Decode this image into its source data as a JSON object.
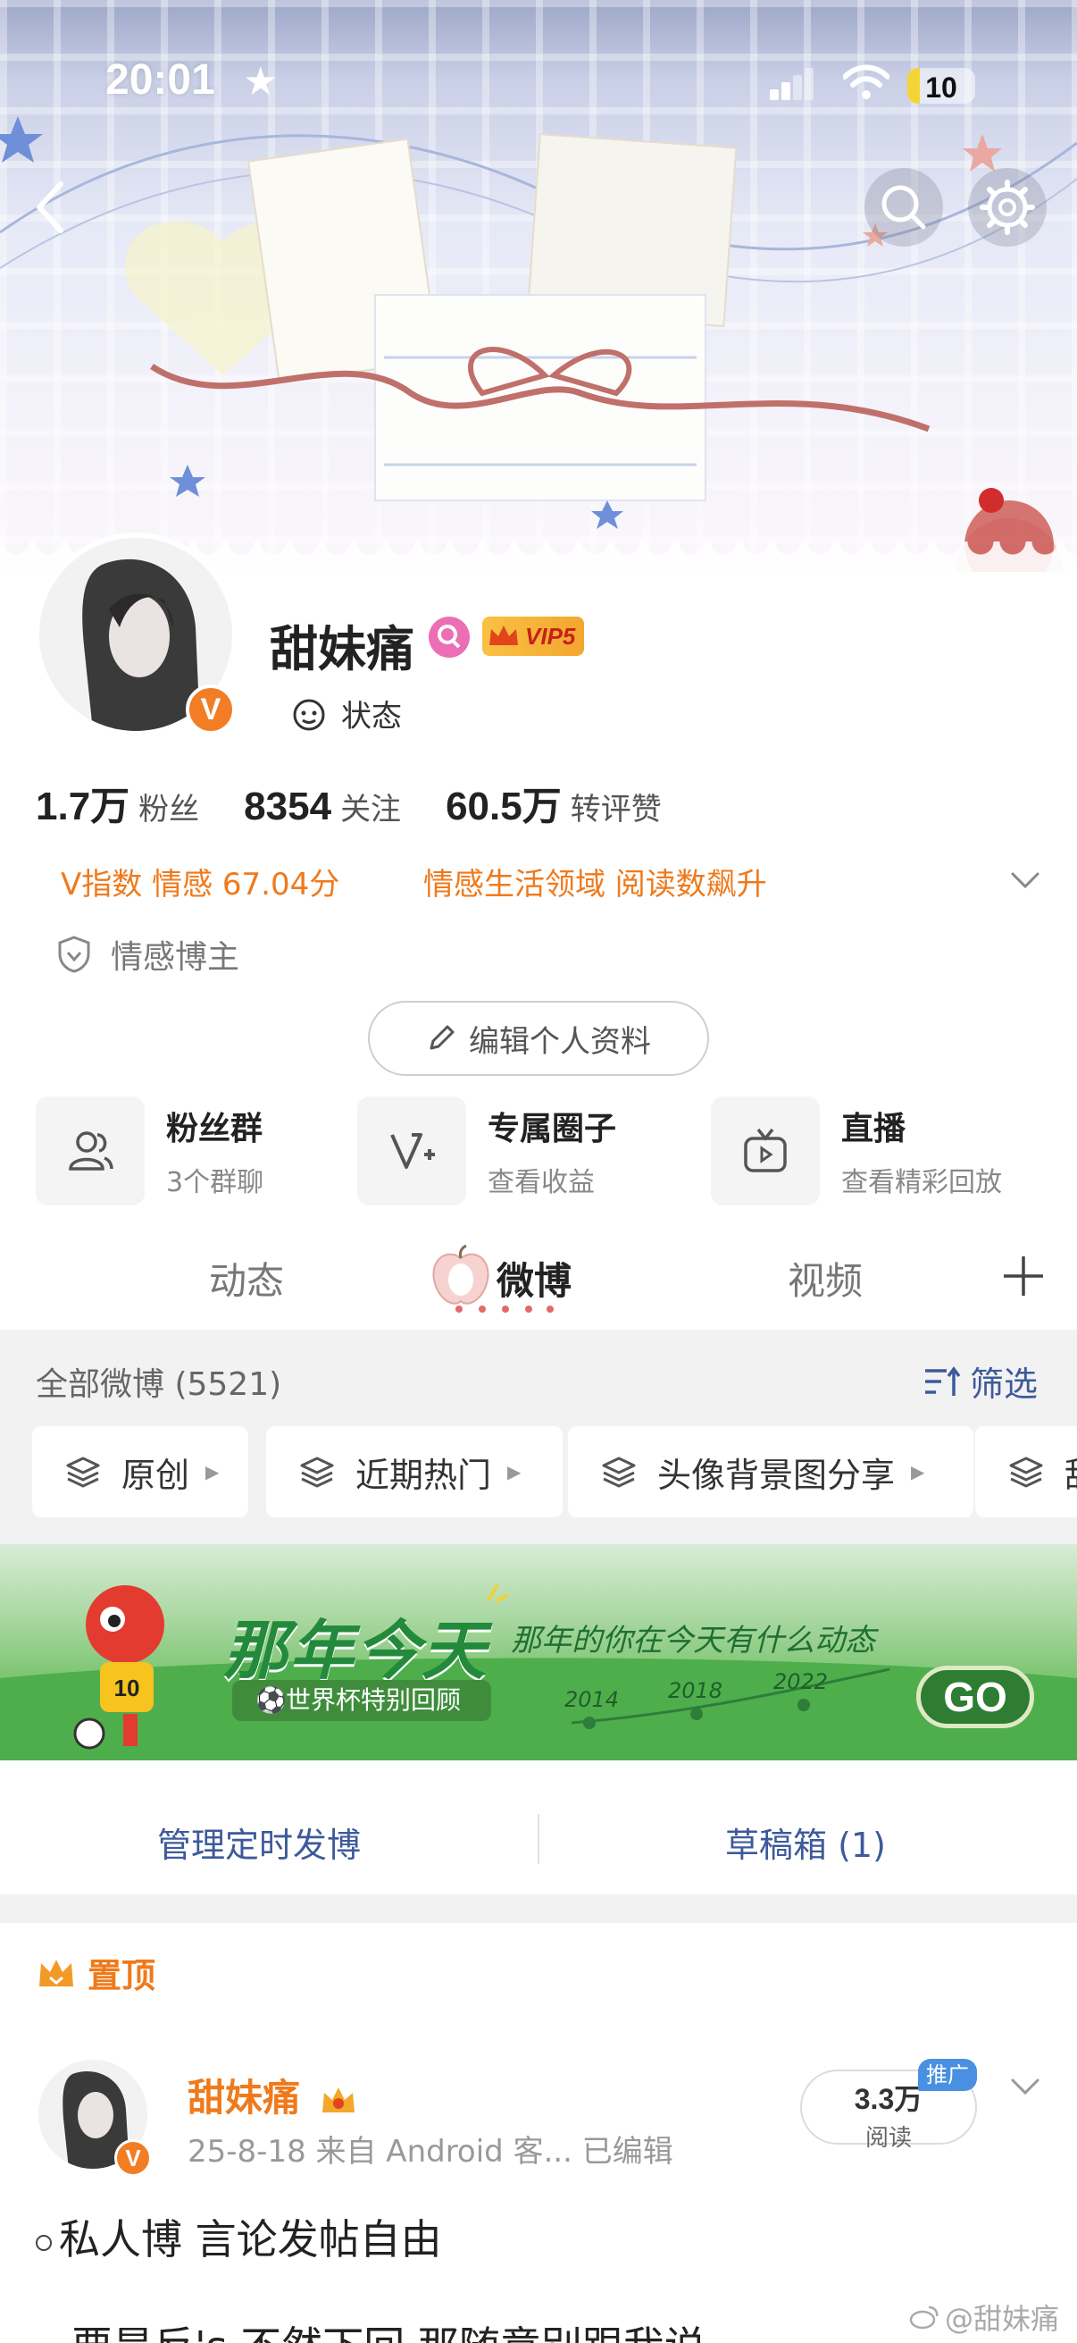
{
  "status_bar": {
    "time": "20:01",
    "battery": "10"
  },
  "profile": {
    "name": "甜妹痛",
    "vip_label": "VIP5",
    "verified_mark": "V",
    "status_label": "状态",
    "stats": [
      {
        "value": "1.7万",
        "label": "粉丝"
      },
      {
        "value": "8354",
        "label": "关注"
      },
      {
        "value": "60.5万",
        "label": "转评赞"
      }
    ],
    "v_index": "V指数 情感 67.04分",
    "domain_text": "情感生活领域 阅读数飙升",
    "blogger_tag": "情感博主",
    "edit_button": "编辑个人资料"
  },
  "features": [
    {
      "title": "粉丝群",
      "subtitle": "3个群聊",
      "icon": "users-icon"
    },
    {
      "title": "专属圈子",
      "subtitle": "查看收益",
      "icon": "circle-v-icon"
    },
    {
      "title": "直播",
      "subtitle": "查看精彩回放",
      "icon": "tv-icon"
    }
  ],
  "tabs": [
    {
      "label": "动态",
      "active": false
    },
    {
      "label": "微博",
      "active": true
    },
    {
      "label": "视频",
      "active": false
    }
  ],
  "feed_header": {
    "all_label": "全部微博 (5521)",
    "filter_label": "筛选"
  },
  "chips": [
    "原创",
    "近期热门",
    "头像背景图分享",
    "甜"
  ],
  "promo": {
    "title": "那年今天",
    "subtitle": "那年的你在今天有什么动态",
    "pill": "世界杯特别回顾",
    "years": [
      "2014",
      "2018",
      "2022"
    ],
    "go": "GO",
    "mascot_number": "10"
  },
  "management": {
    "scheduled": "管理定时发博",
    "drafts": "草稿箱 (1)"
  },
  "pinned_label": "置顶",
  "post": {
    "author": "甜妹痛",
    "meta": "25-8-18  来自 Android 客...  已编辑",
    "reads_value": "3.3万",
    "reads_label": "阅读",
    "promo_tag": "推广",
    "text": "私人博 言论发帖自由",
    "text2": "要是反's 不然下回 那随意别跟我说"
  },
  "watermark": "@甜妹痛",
  "colors": {
    "accent_orange": "#ef7a1c",
    "link_blue": "#3d5a9a",
    "vip_gold": "#f3a62f"
  }
}
